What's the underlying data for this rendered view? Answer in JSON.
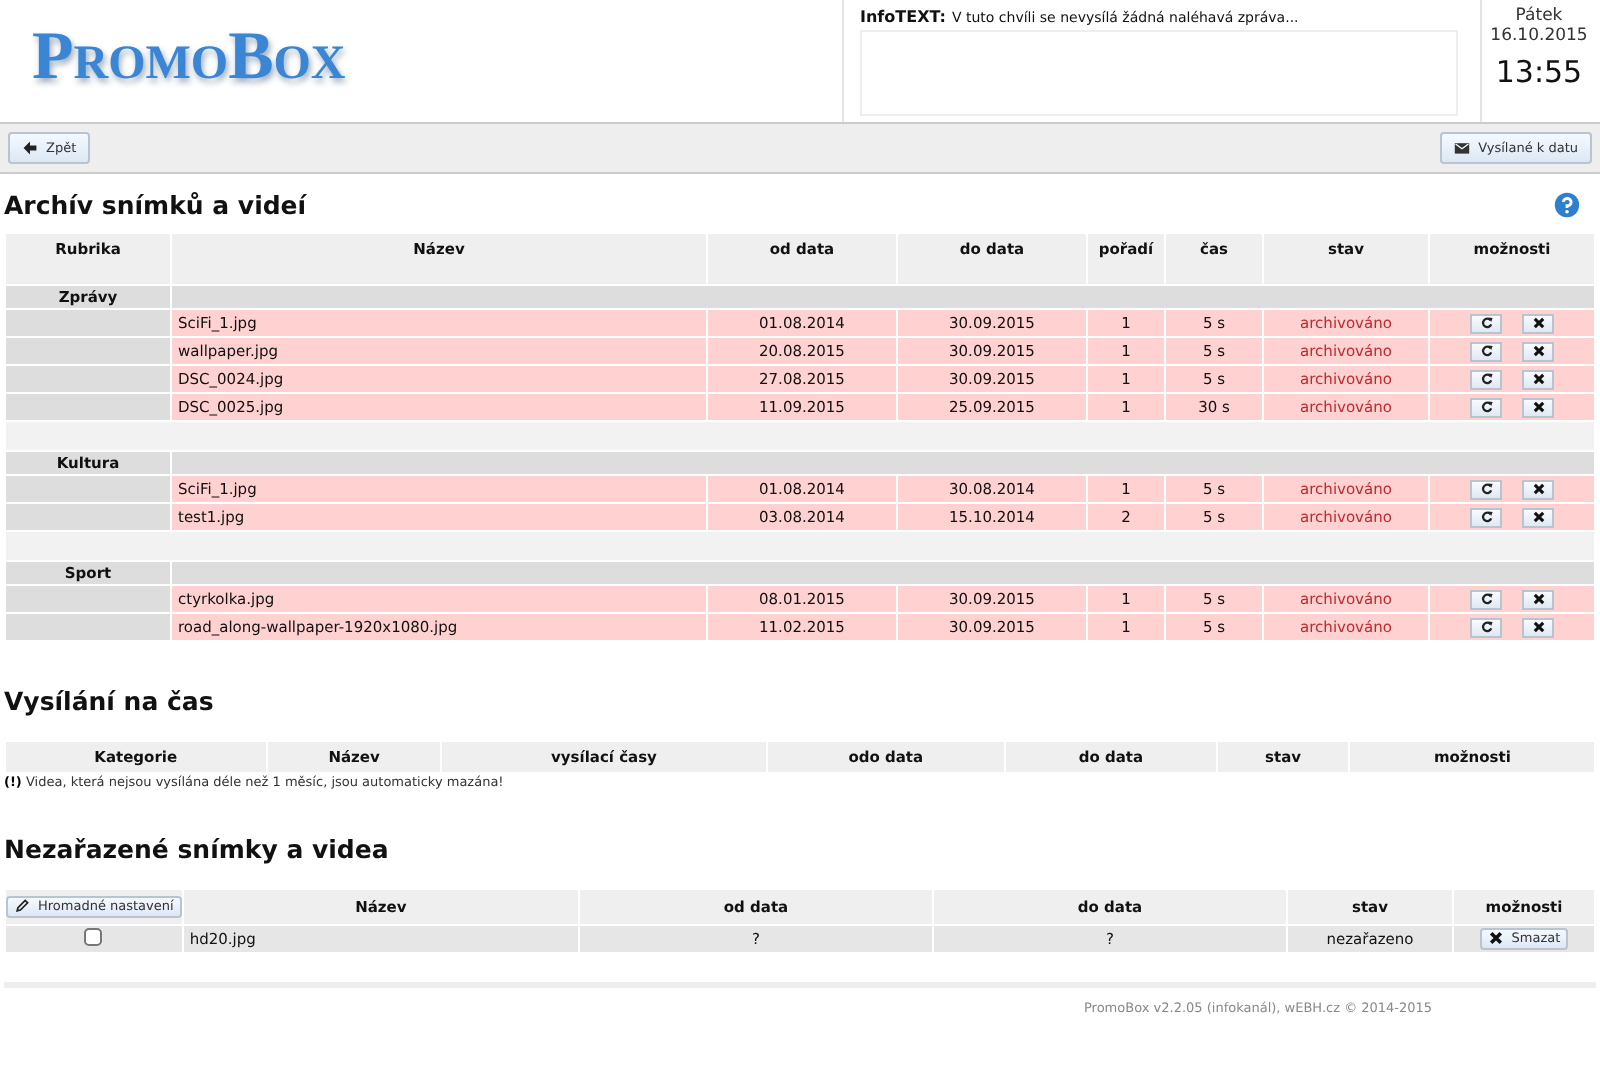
{
  "header": {
    "logo": "PromoBox",
    "info_label": "InfoTEXT:",
    "info_message": "V tuto chvíli se nevysílá žádná naléhavá zpráva...",
    "day": "Pátek",
    "date": "16.10.2015",
    "time": "13:55"
  },
  "toolbar": {
    "back_button": "Zpět",
    "dated_button": "Vysílané k datu"
  },
  "archive": {
    "title": "Archív snímků a videí",
    "columns": [
      "Rubrika",
      "Název",
      "od data",
      "do data",
      "pořadí",
      "čas",
      "stav",
      "možnosti"
    ],
    "groups": [
      {
        "name": "Zprávy",
        "items": [
          {
            "name": "SciFi_1.jpg",
            "from": "01.08.2014",
            "to": "30.09.2015",
            "order": "1",
            "time": "5 s",
            "status": "archivováno"
          },
          {
            "name": "wallpaper.jpg",
            "from": "20.08.2015",
            "to": "30.09.2015",
            "order": "1",
            "time": "5 s",
            "status": "archivováno"
          },
          {
            "name": "DSC_0024.jpg",
            "from": "27.08.2015",
            "to": "30.09.2015",
            "order": "1",
            "time": "5 s",
            "status": "archivováno"
          },
          {
            "name": "DSC_0025.jpg",
            "from": "11.09.2015",
            "to": "25.09.2015",
            "order": "1",
            "time": "30 s",
            "status": "archivováno"
          }
        ]
      },
      {
        "name": "Kultura",
        "items": [
          {
            "name": "SciFi_1.jpg",
            "from": "01.08.2014",
            "to": "30.08.2014",
            "order": "1",
            "time": "5 s",
            "status": "archivováno"
          },
          {
            "name": "test1.jpg",
            "from": "03.08.2014",
            "to": "15.10.2014",
            "order": "2",
            "time": "5 s",
            "status": "archivováno"
          }
        ]
      },
      {
        "name": "Sport",
        "items": [
          {
            "name": "ctyrkolka.jpg",
            "from": "08.01.2015",
            "to": "30.09.2015",
            "order": "1",
            "time": "5 s",
            "status": "archivováno"
          },
          {
            "name": "road_along-wallpaper-1920x1080.jpg",
            "from": "11.02.2015",
            "to": "30.09.2015",
            "order": "1",
            "time": "5 s",
            "status": "archivováno"
          }
        ]
      }
    ]
  },
  "scheduled": {
    "title": "Vysílání na čas",
    "columns": [
      "Kategorie",
      "Název",
      "vysílací časy",
      "odo data",
      "do data",
      "stav",
      "možnosti"
    ],
    "note": "**(!)** Videa, která nejsou vysílána déle než 1 měsíc, jsou automaticky mazána!"
  },
  "unassigned": {
    "title": "Nezařazené snímky a videa",
    "bulk_button": "Hromadné nastavení",
    "columns": [
      "Název",
      "od data",
      "do data",
      "stav",
      "možnosti"
    ],
    "rows": [
      {
        "checked": false,
        "name": "hd20.jpg",
        "from": "?",
        "to": "?",
        "status": "nezařazeno",
        "delete_button": "Smazat"
      }
    ]
  },
  "footer": "PromoBox v2.2.05 (infokanál), wEBH.cz © 2014-2015"
}
